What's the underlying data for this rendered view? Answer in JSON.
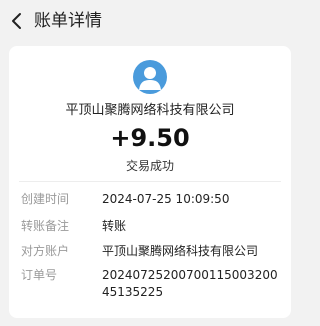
{
  "header": {
    "title": "账单详情",
    "back_icon": "chevron-left-icon"
  },
  "summary": {
    "avatar_icon": "user-avatar-icon",
    "avatar_color": "#4a9bdc",
    "merchant": "平顶山聚腾网络科技有限公司",
    "amount": "+9.50",
    "status": "交易成功"
  },
  "details": [
    {
      "label": "创建时间",
      "value": "2024-07-25 10:09:50"
    },
    {
      "label": "转账备注",
      "value": "转账"
    },
    {
      "label": "对方账户",
      "value": "平顶山聚腾网络科技有限公司"
    },
    {
      "label": "订单号",
      "value": "2024072520070011500320045135225"
    }
  ]
}
